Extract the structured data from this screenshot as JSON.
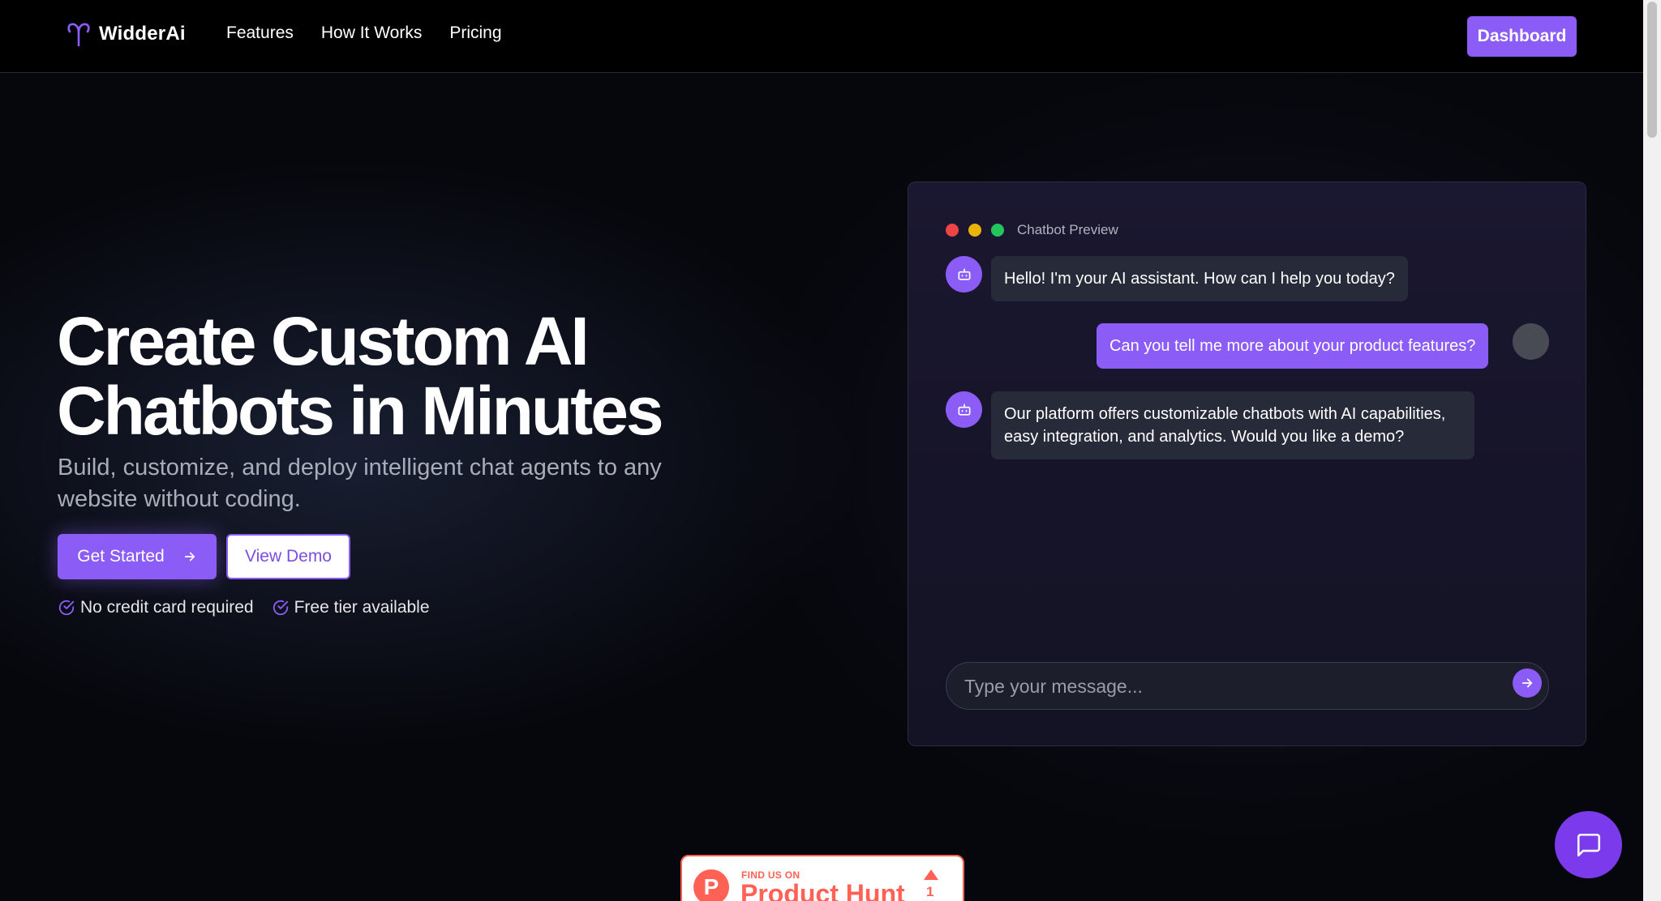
{
  "nav": {
    "brand": "WidderAi",
    "links": [
      {
        "label": "Features"
      },
      {
        "label": "How It Works"
      },
      {
        "label": "Pricing"
      }
    ],
    "dashboard_label": "Dashboard"
  },
  "hero": {
    "title_line1": "Create Custom AI",
    "title_line2": "Chatbots in Minutes",
    "subtitle": "Build, customize, and deploy intelligent chat agents to any website without coding.",
    "primary_cta": "Get Started",
    "secondary_cta": "View Demo",
    "perks": [
      "No credit card required",
      "Free tier available"
    ]
  },
  "preview": {
    "label": "Chatbot Preview",
    "messages": [
      {
        "from": "bot",
        "text": "Hello! I'm your AI assistant. How can I help you today?"
      },
      {
        "from": "user",
        "text": "Can you tell me more about your product features?"
      },
      {
        "from": "bot",
        "text": "Our platform offers customizable chatbots with AI capabilities, easy integration, and analytics. Would you like a demo?"
      }
    ],
    "input_placeholder": "Type your message..."
  },
  "product_hunt": {
    "find_label": "FIND US ON",
    "name": "Product Hunt",
    "upvotes": "1"
  },
  "colors": {
    "accent": "#8b5cf6",
    "background": "#06070c",
    "product_hunt": "#ff6154"
  },
  "icons": {
    "logo": "aries-icon",
    "arrow": "arrow-right-icon",
    "check": "check-circle-icon",
    "bot": "bot-icon",
    "send": "send-arrow-icon",
    "chat": "message-square-icon"
  }
}
